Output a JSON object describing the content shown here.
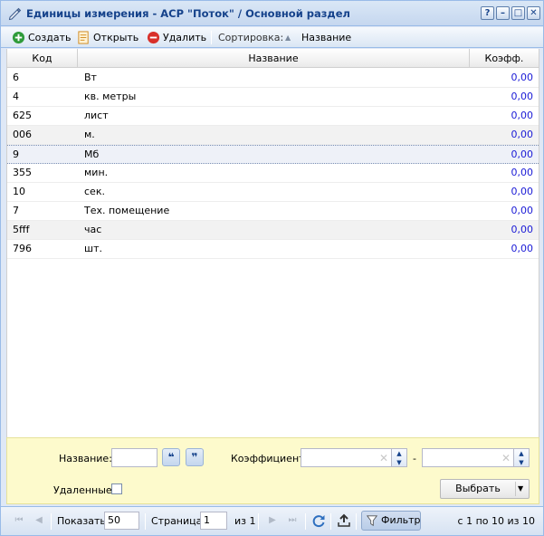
{
  "window": {
    "title": "Единицы измерения - АСР \"Поток\" / Основной раздел",
    "buttons": [
      "?",
      "–",
      "□",
      "✕"
    ]
  },
  "toolbar": {
    "create_label": "Создать",
    "open_label": "Открыть",
    "delete_label": "Удалить",
    "sort_label": "Сортировка:",
    "sort_field_label": "Название"
  },
  "grid": {
    "columns": [
      "Код",
      "Название",
      "Коэфф."
    ],
    "rows": [
      {
        "code": "6",
        "name": "Вт",
        "coef": "0,00"
      },
      {
        "code": "4",
        "name": "кв. метры",
        "coef": "0,00"
      },
      {
        "code": "625",
        "name": "лист",
        "coef": "0,00"
      },
      {
        "code": "006",
        "name": "м.",
        "coef": "0,00"
      },
      {
        "code": "9",
        "name": "Мб",
        "coef": "0,00"
      },
      {
        "code": "355",
        "name": "мин.",
        "coef": "0,00"
      },
      {
        "code": "10",
        "name": "сек.",
        "coef": "0,00"
      },
      {
        "code": "7",
        "name": "Тех. помещение",
        "coef": "0,00"
      },
      {
        "code": "5fff",
        "name": "час",
        "coef": "0,00"
      },
      {
        "code": "796",
        "name": "шт.",
        "coef": "0,00"
      }
    ]
  },
  "filter": {
    "name_label": "Название:",
    "name_value": "",
    "coef_label": "Коэффициент:",
    "coef_from": "",
    "coef_to": "",
    "dash": "-",
    "deleted_label": "Удаленные:",
    "select_label": "Выбрать"
  },
  "pager": {
    "show_label": "Показать",
    "page_size": "50",
    "page_label": "Страница",
    "page_value": "1",
    "of_label": "из 1",
    "filter_label": "Фильтр",
    "summary": "с 1 по 10 из 10"
  },
  "colors": {
    "accent": "#15428b",
    "value_blue": "#1a1ad6",
    "filter_bg": "#fdfacc"
  }
}
